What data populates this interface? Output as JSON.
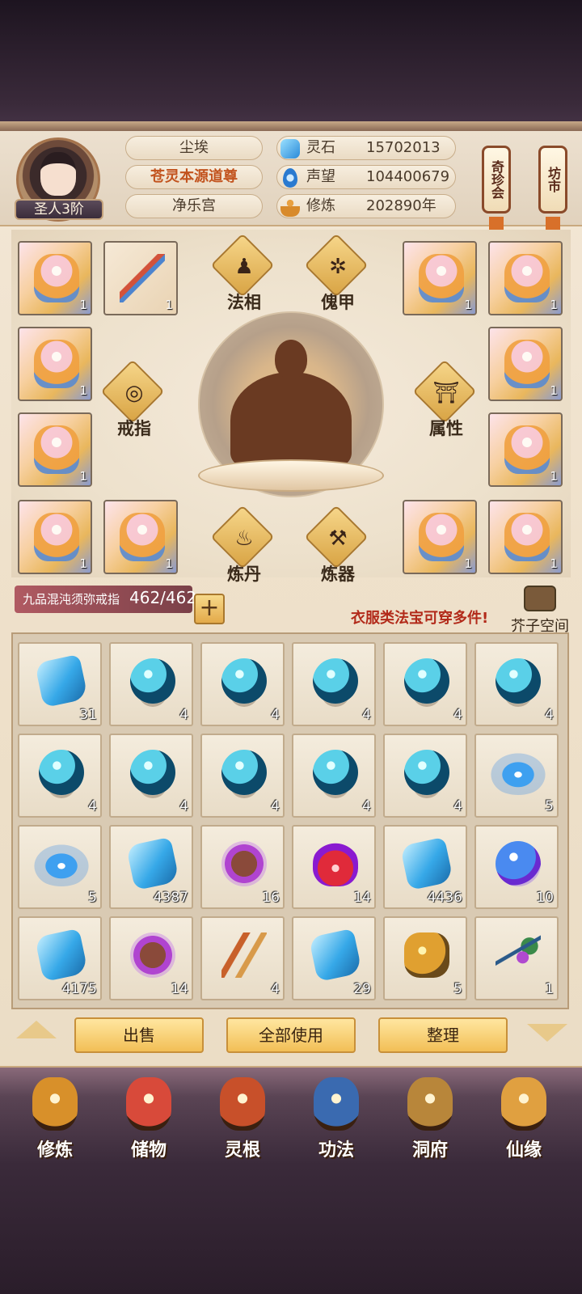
{
  "player": {
    "rank": "圣人3阶",
    "name": "尘埃",
    "title": "苍灵本源道尊",
    "sect": "净乐宫"
  },
  "resources": [
    {
      "label": "灵石",
      "value": "15702013",
      "icon": "spirit-stone-icon"
    },
    {
      "label": "声望",
      "value": "104400679",
      "icon": "prestige-icon"
    },
    {
      "label": "修炼",
      "value": "202890年",
      "icon": "cultivation-icon"
    }
  ],
  "side_tags": {
    "treasure_fair": "奇珍会",
    "market": "坊市"
  },
  "equip_slots": {
    "left_top": [
      {
        "count": "1",
        "item": "celestial-robe"
      },
      {
        "count": "1",
        "item": "bow"
      }
    ],
    "right_top": [
      {
        "count": "1",
        "item": "celestial-robe"
      },
      {
        "count": "1",
        "item": "celestial-robe"
      }
    ],
    "left_mid": [
      {
        "count": "1",
        "item": "celestial-robe"
      },
      {
        "count": "1",
        "item": "celestial-robe"
      }
    ],
    "right_mid": [
      {
        "count": "1",
        "item": "celestial-robe"
      },
      {
        "count": "1",
        "item": "celestial-robe"
      }
    ],
    "left_bottom": [
      {
        "count": "1",
        "item": "celestial-robe"
      },
      {
        "count": "1",
        "item": "celestial-robe"
      }
    ],
    "right_bottom": [
      {
        "count": "1",
        "item": "celestial-robe"
      },
      {
        "count": "1",
        "item": "celestial-robe"
      }
    ]
  },
  "equip_buttons": {
    "dharma_form": "法相",
    "puppet_armor": "傀甲",
    "ring": "戒指",
    "attributes": "属性",
    "alchemy": "炼丹",
    "forging": "炼器"
  },
  "ring_bar": {
    "name": "九品混沌须弥戒指",
    "capacity": "462/462",
    "plus": "+"
  },
  "hint": "衣服类法宝可穿多件!",
  "storage_space": "芥子空间",
  "inventory": [
    {
      "art": "crystal",
      "count": "31"
    },
    {
      "art": "orb",
      "count": "4"
    },
    {
      "art": "orb",
      "count": "4"
    },
    {
      "art": "orb",
      "count": "4"
    },
    {
      "art": "orb",
      "count": "4"
    },
    {
      "art": "orb",
      "count": "4"
    },
    {
      "art": "orb",
      "count": "4"
    },
    {
      "art": "orb",
      "count": "4"
    },
    {
      "art": "orb",
      "count": "4"
    },
    {
      "art": "orb",
      "count": "4"
    },
    {
      "art": "orb",
      "count": "4"
    },
    {
      "art": "swirl",
      "count": "5"
    },
    {
      "art": "swirl",
      "count": "5"
    },
    {
      "art": "crystal",
      "count": "4387"
    },
    {
      "art": "purple",
      "count": "16"
    },
    {
      "art": "fire",
      "count": "14"
    },
    {
      "art": "crystal",
      "count": "4436"
    },
    {
      "art": "bubble",
      "count": "10"
    },
    {
      "art": "crystal",
      "count": "4175"
    },
    {
      "art": "purple",
      "count": "14"
    },
    {
      "art": "root",
      "count": "4"
    },
    {
      "art": "crystal",
      "count": "29"
    },
    {
      "art": "gold",
      "count": "5"
    },
    {
      "art": "plant",
      "count": "1"
    }
  ],
  "actions": {
    "sell": "出售",
    "use_all": "全部使用",
    "sort": "整理"
  },
  "nav": [
    {
      "label": "修炼",
      "icon": "cultivate-icon",
      "color": "#d8902a"
    },
    {
      "label": "储物",
      "icon": "storage-bag-icon",
      "color": "#d84a3a"
    },
    {
      "label": "灵根",
      "icon": "spirit-root-icon",
      "color": "#c8502a"
    },
    {
      "label": "功法",
      "icon": "technique-book-icon",
      "color": "#3a6ab0"
    },
    {
      "label": "洞府",
      "icon": "cave-dwelling-icon",
      "color": "#b8863a"
    },
    {
      "label": "仙缘",
      "icon": "immortal-fate-icon",
      "color": "#e0a040"
    }
  ],
  "colors": {
    "accent_title": "#c2531e",
    "hint_red": "#b22a1a",
    "button_gold": "#f2bf56"
  }
}
